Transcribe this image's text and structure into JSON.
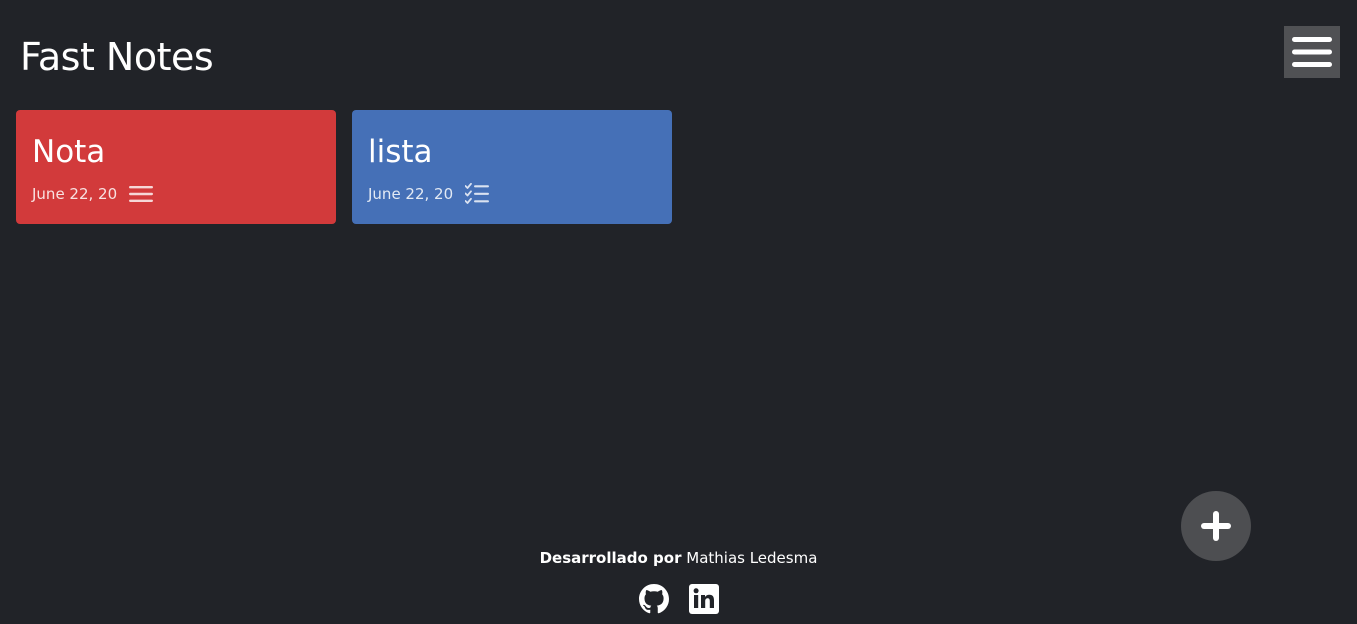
{
  "header": {
    "title": "Fast Notes",
    "menu_icon": "hamburger-menu-icon"
  },
  "notes": [
    {
      "title": "Nota",
      "date": "June 22, 20",
      "type_icon": "text-lines-icon",
      "color": "#d23a3b"
    },
    {
      "title": "lista",
      "date": "June 22, 20",
      "type_icon": "checklist-icon",
      "color": "#4570b7"
    }
  ],
  "fab": {
    "icon": "plus-icon"
  },
  "footer": {
    "credit_label": "Desarrollado por",
    "credit_name": "Mathias Ledesma",
    "links": [
      {
        "icon": "github-icon"
      },
      {
        "icon": "linkedin-icon"
      }
    ]
  }
}
